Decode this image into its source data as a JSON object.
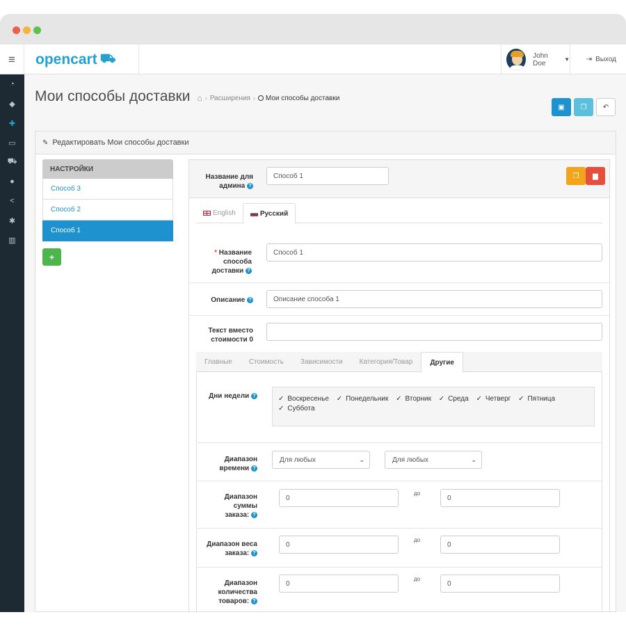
{
  "header": {
    "logo": "opencart",
    "user_name": "John Doe",
    "logout": "Выход"
  },
  "page": {
    "title": "Мои способы доставки",
    "breadcrumbs": [
      "Расширения",
      "Мои способы доставки"
    ]
  },
  "panel": {
    "heading": "Редактировать Мои способы доставки"
  },
  "sidebar_left": {
    "heading": "НАСТРОЙКИ",
    "items": [
      {
        "label": "Способ 3",
        "active": false
      },
      {
        "label": "Способ 2",
        "active": false
      },
      {
        "label": "Способ 1",
        "active": true
      }
    ],
    "add_icon": "plus-icon"
  },
  "form": {
    "admin_name_label": "Название для админа",
    "admin_name_value": "Способ 1",
    "lang_tabs": [
      "English",
      "Русский"
    ],
    "active_lang": "Русский",
    "method_name_label": "Название способа доставки",
    "method_name_value": "Способ 1",
    "description_label": "Описание",
    "description_value": "Описание способа 1",
    "zero_cost_label": "Текст вместо стоимости 0",
    "zero_cost_value": "",
    "sub_tabs": [
      "Главные",
      "Стоимость",
      "Зависимости",
      "Категория/Товар",
      "Другие"
    ],
    "active_sub_tab": "Другие",
    "weekdays_label": "Дни недели",
    "weekdays": [
      "Воскресенье",
      "Понедельник",
      "Вторник",
      "Среда",
      "Четверг",
      "Пятница",
      "Суббота"
    ],
    "time_range_label": "Диапазон времени",
    "time_from": "Для любых",
    "time_to": "Для любых",
    "sum_range_label": "Диапазон суммы заказа:",
    "sum_from": "0",
    "sum_to": "0",
    "weight_range_label": "Диапазон веса заказа:",
    "weight_from": "0",
    "weight_to": "0",
    "qty_range_label": "Диапазон количества товаров:",
    "qty_from": "0",
    "qty_to": "0",
    "to_word": "до"
  },
  "colors": {
    "accent": "#1e91cf",
    "sidebar_bg": "#1e2a33",
    "success": "#4cb64c",
    "warning": "#f2a41f",
    "danger": "#e3503e"
  }
}
